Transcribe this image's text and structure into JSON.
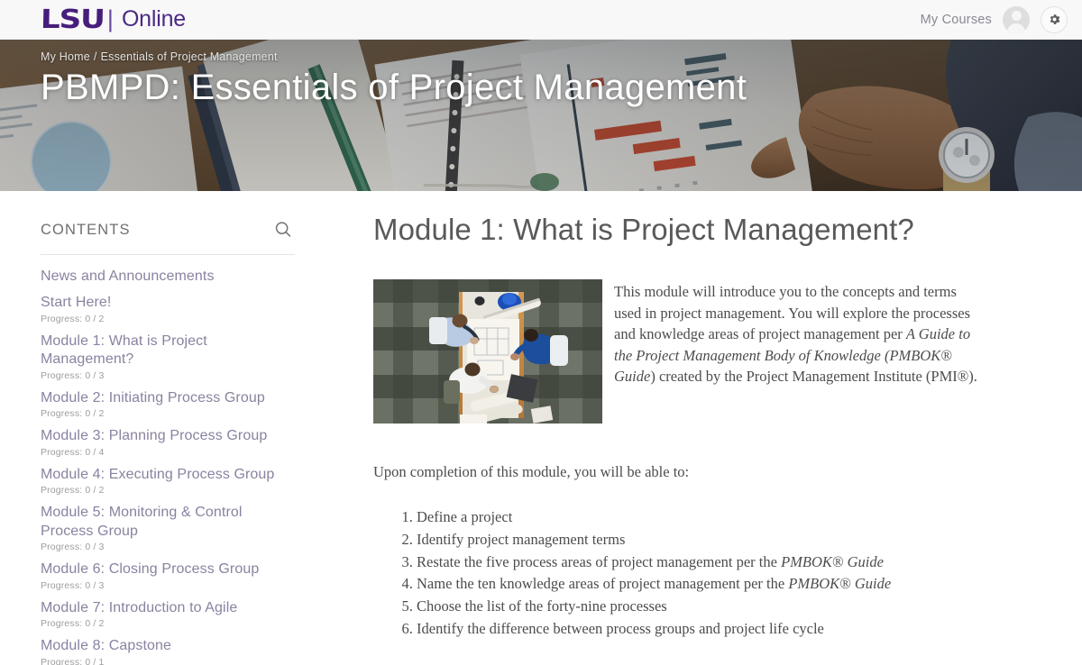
{
  "header": {
    "logo_lsu": "LSU",
    "logo_divider": "|",
    "logo_online": "Online",
    "my_courses": "My Courses",
    "avatar_icon": "user-avatar-icon",
    "settings_icon": "gear-icon"
  },
  "banner": {
    "breadcrumb": [
      {
        "label": "My Home"
      },
      {
        "label": "Essentials of Project Management"
      }
    ],
    "breadcrumb_separator": "/",
    "title": "PBMPD: Essentials of Project Management",
    "image_alt": "Desk with financial report documents, notebooks, eyeglasses and a hand wearing a wristwatch"
  },
  "sidebar": {
    "heading": "CONTENTS",
    "search_icon": "search-icon",
    "items": [
      {
        "label": "News and Announcements",
        "progress": null
      },
      {
        "label": "Start Here!",
        "progress": "Progress: 0 / 2"
      },
      {
        "label": "Module 1: What is Project Management?",
        "progress": "Progress: 0 / 3"
      },
      {
        "label": "Module 2: Initiating Process Group",
        "progress": "Progress: 0 / 2"
      },
      {
        "label": "Module 3: Planning Process Group",
        "progress": "Progress: 0 / 4"
      },
      {
        "label": "Module 4: Executing Process Group",
        "progress": "Progress: 0 / 2"
      },
      {
        "label": "Module 5: Monitoring & Control Process Group",
        "progress": "Progress: 0 / 3"
      },
      {
        "label": "Module 6: Closing Process Group",
        "progress": "Progress: 0 / 3"
      },
      {
        "label": "Module 7: Introduction to Agile",
        "progress": "Progress: 0 / 2"
      },
      {
        "label": "Module 8: Capstone",
        "progress": "Progress: 0 / 1"
      }
    ]
  },
  "main": {
    "title": "Module 1: What is Project Management?",
    "photo_alt": "Overhead view of three people meeting around a table with blueprints and a blue hard hat",
    "intro": {
      "part1": "This module will introduce you to the concepts and terms used in project management. You will explore the processes and knowledge areas of project management per ",
      "italic1": "A Guide to the Project Management Body of Knowledge (PMBOK® Guide",
      "part2": ") created by the Project Management Institute (PMI®)."
    },
    "upon_completion": "Upon completion of this module, you will be able to:",
    "objectives": [
      {
        "text": "Define a project",
        "italic": null,
        "tail": null
      },
      {
        "text": "Identify project management terms",
        "italic": null,
        "tail": null
      },
      {
        "text": "Restate the five process areas of project management per the ",
        "italic": "PMBOK® Guide",
        "tail": ""
      },
      {
        "text": "Name the ten knowledge areas of project management per the ",
        "italic": "PMBOK® Guide",
        "tail": ""
      },
      {
        "text": "Choose the list of the forty-nine processes",
        "italic": null,
        "tail": null
      },
      {
        "text": "Identify the difference between process groups and project life cycle",
        "italic": null,
        "tail": null
      }
    ]
  },
  "colors": {
    "brand_purple": "#461D7C",
    "link_purple": "#8a82a0",
    "header_bg": "#f8f8f9",
    "body_text": "#4c4c4c"
  }
}
